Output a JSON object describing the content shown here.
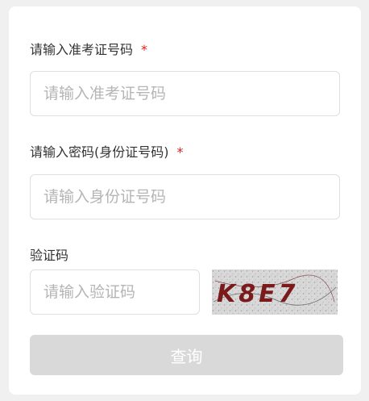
{
  "form": {
    "exam_no": {
      "label": "请输入准考证号码",
      "required_mark": "*",
      "placeholder": "请输入准考证号码",
      "value": ""
    },
    "password": {
      "label": "请输入密码(身份证号码)",
      "required_mark": "*",
      "placeholder": "请输入身份证号码",
      "value": ""
    },
    "captcha": {
      "label": "验证码",
      "placeholder": "请输入验证码",
      "value": "",
      "image_text": "K8E7"
    },
    "submit_label": "查询"
  },
  "colors": {
    "required": "#e02020",
    "button_bg": "#d9d9d9",
    "captcha_text": "#7a1a1a"
  }
}
